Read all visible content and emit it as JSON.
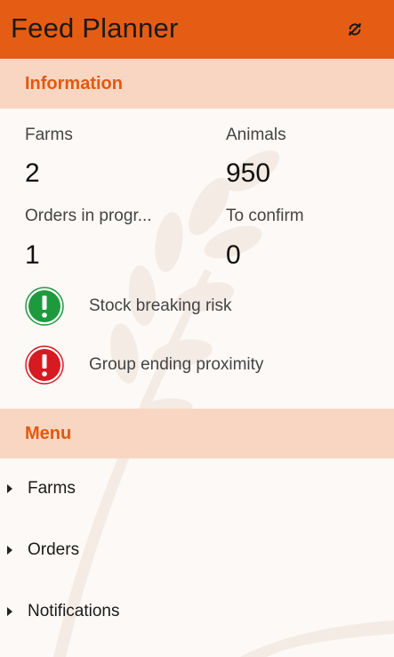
{
  "header": {
    "title": "Feed Planner",
    "sync_icon": "sync-disabled-icon",
    "color": "#e55d14"
  },
  "information": {
    "heading": "Information",
    "stats": [
      {
        "label": "Farms",
        "value": "2"
      },
      {
        "label": "Animals",
        "value": "950"
      },
      {
        "label": "Orders in progr...",
        "value": "1"
      },
      {
        "label": "To confirm",
        "value": "0"
      }
    ],
    "alerts": [
      {
        "label": "Stock breaking risk",
        "icon": "exclamation-icon",
        "color": "#1e9a3e"
      },
      {
        "label": "Group ending proximity",
        "icon": "exclamation-icon",
        "color": "#d71a21"
      }
    ]
  },
  "menu": {
    "heading": "Menu",
    "items": [
      {
        "label": "Farms"
      },
      {
        "label": "Orders"
      },
      {
        "label": "Notifications"
      }
    ]
  },
  "colors": {
    "accent": "#e55d14",
    "section_bg": "#f9d6c1",
    "section_text": "#e2590f",
    "background": "#fdf9f6"
  }
}
